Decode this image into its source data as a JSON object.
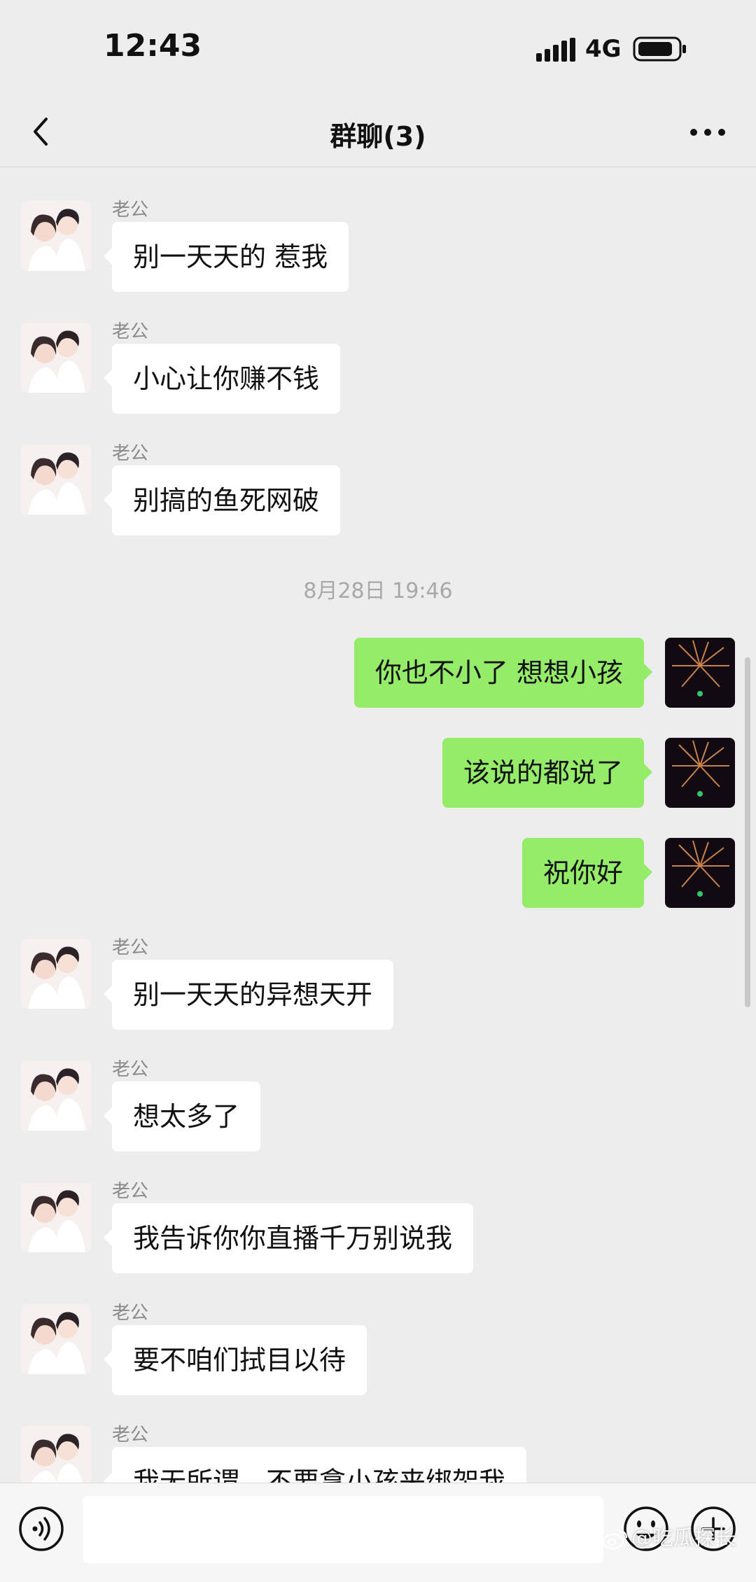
{
  "status_bar": {
    "time": "12:43",
    "network": "4G",
    "signal_icon": "signal-bars-icon",
    "battery_icon": "battery-icon"
  },
  "nav": {
    "title": "群聊(3)",
    "back_icon": "chevron-left-icon",
    "more_icon": "more-dots-icon"
  },
  "messages": [
    {
      "sender": "老公",
      "text": "别一天天的 惹我"
    },
    {
      "sender": "老公",
      "text": "小心让你赚不钱"
    },
    {
      "sender": "老公",
      "text": "别搞的鱼死网破"
    },
    {
      "timestamp": "8月28日 19:46"
    },
    {
      "text": "你也不小了 想想小孩"
    },
    {
      "text": "该说的都说了"
    },
    {
      "text": "祝你好"
    },
    {
      "sender": "老公",
      "text": "别一天天的异想天开"
    },
    {
      "sender": "老公",
      "text": "想太多了"
    },
    {
      "sender": "老公",
      "text": "我告诉你你直播千万别说我"
    },
    {
      "sender": "老公",
      "text": "要不咱们拭目以待"
    },
    {
      "sender": "老公",
      "text": "我无所谓，不要拿小孩来绑架我"
    }
  ],
  "input_bar": {
    "voice_icon": "voice-icon",
    "emoji_icon": "emoji-icon",
    "plus_icon": "plus-circle-icon",
    "placeholder": ""
  },
  "watermark": {
    "text": "@吃瓜探长"
  },
  "colors": {
    "background": "#ededed",
    "incoming_bubble": "#ffffff",
    "outgoing_bubble": "#95ec69",
    "sender_name": "#8a8a8a",
    "timestamp": "#a8a8a8"
  }
}
